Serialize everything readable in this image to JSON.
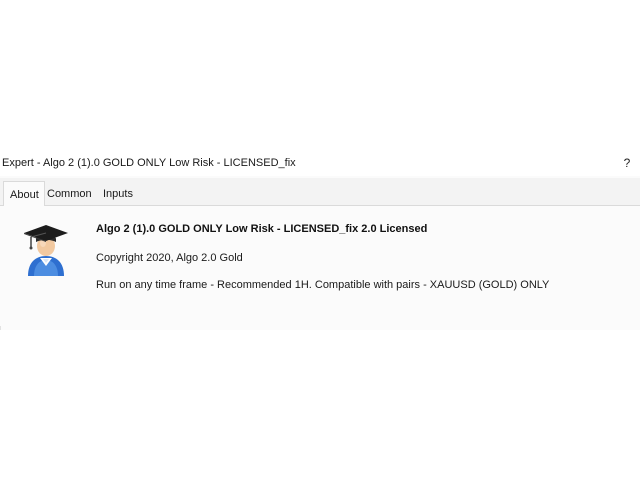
{
  "window": {
    "title": "Expert - Algo 2 (1).0 GOLD ONLY Low Risk - LICENSED_fix",
    "help_label": "?"
  },
  "tabs": [
    {
      "label": "About",
      "active": true
    },
    {
      "label": "Common",
      "active": false
    },
    {
      "label": "Inputs",
      "active": false
    }
  ],
  "about": {
    "icon": "expert-graduate-icon",
    "name": "Algo 2 (1).0 GOLD ONLY Low Risk - LICENSED_fix 2.0 Licensed",
    "copyright": "Copyright 2020, Algo 2.0 Gold",
    "description": "Run on any time frame - Recommended 1H. Compatible with pairs - XAUUSD (GOLD) ONLY"
  },
  "colors": {
    "dialog_background": "#fbfbfb",
    "tabbar_background": "#f3f3f3",
    "cap_black": "#1c1c1c",
    "person_blue": "#2e6fd0"
  }
}
